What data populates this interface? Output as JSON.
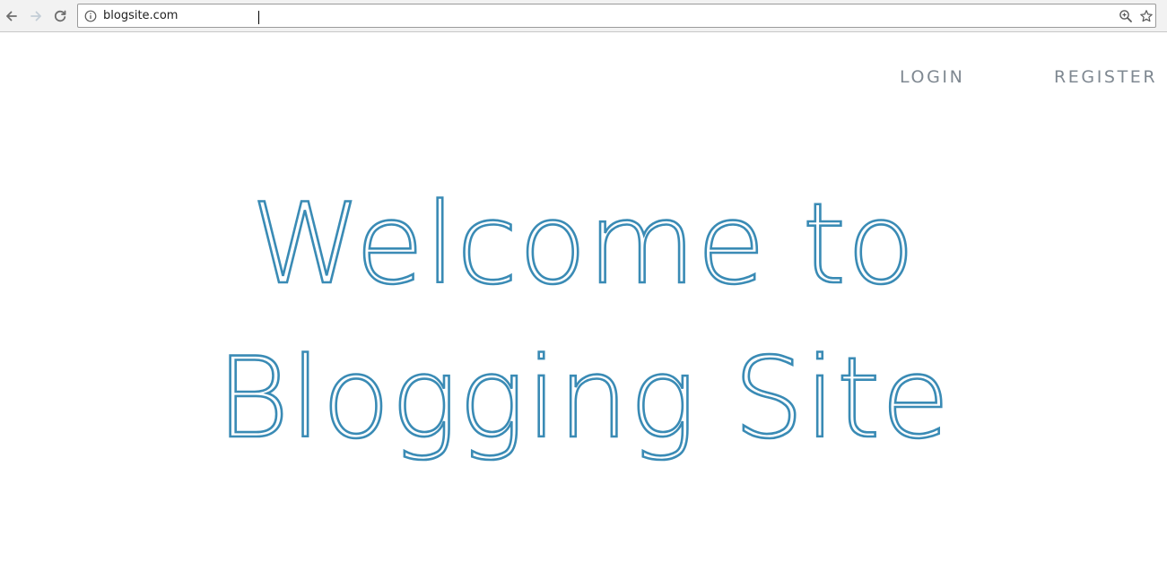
{
  "browser": {
    "url": "blogsite.com",
    "icons": {
      "back": "arrow-left-icon",
      "forward": "arrow-right-icon",
      "reload": "reload-icon",
      "info": "info-icon",
      "zoom": "zoom-icon",
      "bookmark": "star-icon"
    }
  },
  "nav": {
    "login": "LOGIN",
    "register": "REGISTER"
  },
  "hero": {
    "line1": "Welcome to",
    "line2": "Blogging Site"
  },
  "colors": {
    "accent": "#3a8bb5",
    "nav_text": "#7f8891",
    "chrome_bg": "#f2f2f2"
  }
}
